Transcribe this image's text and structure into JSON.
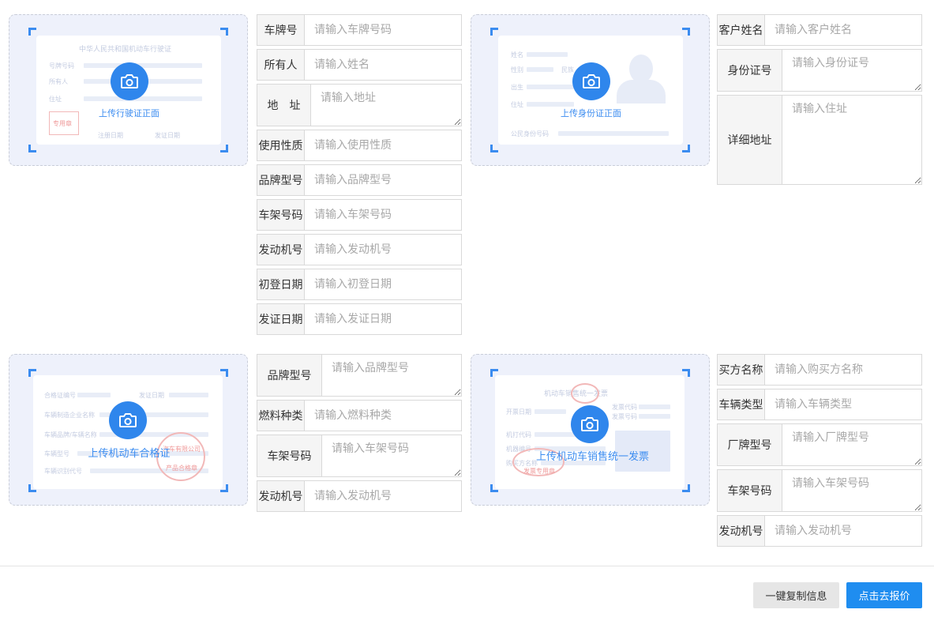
{
  "vehicle_license": {
    "upload_caption": "上传行驶证正面",
    "preview_title": "中华人民共和国机动车行驶证",
    "preview_labels": [
      "号牌号码",
      "所有人",
      "住址",
      "注册日期",
      "发证日期"
    ],
    "preview_stamp": "专用章",
    "fields": [
      {
        "label": "车牌号",
        "placeholder": "请输入车牌号码",
        "multiline": false
      },
      {
        "label": "所有人",
        "placeholder": "请输入姓名",
        "multiline": false
      },
      {
        "label": "地　址",
        "placeholder": "请输入地址",
        "multiline": true
      },
      {
        "label": "使用性质",
        "placeholder": "请输入使用性质",
        "multiline": false
      },
      {
        "label": "品牌型号",
        "placeholder": "请输入品牌型号",
        "multiline": false
      },
      {
        "label": "车架号码",
        "placeholder": "请输入车架号码",
        "multiline": false
      },
      {
        "label": "发动机号",
        "placeholder": "请输入发动机号",
        "multiline": false
      },
      {
        "label": "初登日期",
        "placeholder": "请输入初登日期",
        "multiline": false
      },
      {
        "label": "发证日期",
        "placeholder": "请输入发证日期",
        "multiline": false
      }
    ]
  },
  "id_card": {
    "upload_caption": "上传身份证正面",
    "preview_labels": [
      "姓名",
      "性别",
      "民族",
      "出生",
      "住址",
      "公民身份号码"
    ],
    "fields": [
      {
        "label": "客户姓名",
        "placeholder": "请输入客户姓名",
        "multiline": false
      },
      {
        "label": "身份证号",
        "placeholder": "请输入身份证号",
        "multiline": true
      },
      {
        "label": "详细地址",
        "placeholder": "请输入住址",
        "multiline": true
      }
    ]
  },
  "certificate": {
    "upload_caption": "上传机动车合格证",
    "preview_labels": [
      "合格证编号",
      "发证日期",
      "车辆制造企业名称",
      "车辆品牌/车辆名称",
      "车辆型号",
      "车辆识别代号"
    ],
    "preview_stamp": "汽车有限公司",
    "preview_stamp_sub": "产品合格章",
    "fields": [
      {
        "label": "品牌型号",
        "placeholder": "请输入品牌型号",
        "multiline": true
      },
      {
        "label": "燃料种类",
        "placeholder": "请输入燃料种类",
        "multiline": false
      },
      {
        "label": "车架号码",
        "placeholder": "请输入车架号码",
        "multiline": true
      },
      {
        "label": "发动机号",
        "placeholder": "请输入发动机号",
        "multiline": false
      }
    ]
  },
  "invoice": {
    "upload_caption": "上传机动车销售统一发票",
    "preview_title": "机动车销售统一发票",
    "preview_labels": [
      "开票日期",
      "发票代码",
      "发票号码",
      "机打代码",
      "机器编号",
      "购买方名称"
    ],
    "preview_stamp": "发票专用章",
    "fields": [
      {
        "label": "买方名称",
        "placeholder": "请输入购买方名称",
        "multiline": false
      },
      {
        "label": "车辆类型",
        "placeholder": "请输入车辆类型",
        "multiline": false
      },
      {
        "label": "厂牌型号",
        "placeholder": "请输入厂牌型号",
        "multiline": true
      },
      {
        "label": "车架号码",
        "placeholder": "请输入车架号码",
        "multiline": true
      },
      {
        "label": "发动机号",
        "placeholder": "请输入发动机号",
        "multiline": false
      }
    ]
  },
  "actions": {
    "copy_label": "一键复制信息",
    "quote_label": "点击去报价"
  },
  "colors": {
    "accent": "#2f86ec",
    "primary_button": "#1f8df0",
    "upload_bg": "#eef1fb",
    "label_bg": "#f5f5f5",
    "stamp": "#f2b8b8"
  },
  "icons": {
    "upload": "camera-icon",
    "corner": "corner-bracket"
  }
}
